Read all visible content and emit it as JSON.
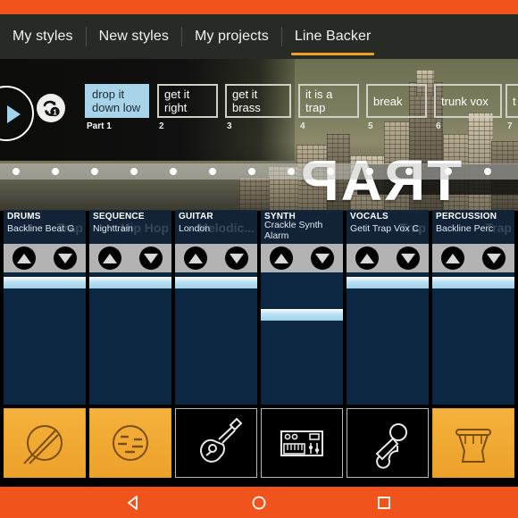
{
  "app": {
    "accent_orange": "#f0531c",
    "tab_underline": "#f0a122",
    "selected_part_blue": "#a8d4ea",
    "track_header_blue": "#132b3c",
    "fader_blue": "#9cd2ec",
    "instrument_active_orange": "#f0a72a"
  },
  "tabs": [
    {
      "label": "My styles",
      "active": false
    },
    {
      "label": "New styles",
      "active": false
    },
    {
      "label": "My projects",
      "active": false
    },
    {
      "label": "Line Backer",
      "active": true
    }
  ],
  "transport": {
    "play_icon": "play-icon",
    "loop_icon": "loop-once-icon",
    "loop_label": "1"
  },
  "background_art": {
    "word": "TRAP"
  },
  "parts": [
    {
      "name": "drop it down low",
      "number": "Part 1",
      "selected": true
    },
    {
      "name": "get it right",
      "number": "2",
      "selected": false
    },
    {
      "name": "get it brass",
      "number": "3",
      "selected": false
    },
    {
      "name": "it is a trap",
      "number": "4",
      "selected": false
    },
    {
      "name": "break",
      "number": "5",
      "selected": false
    },
    {
      "name": "trunk vox",
      "number": "6",
      "selected": false
    },
    {
      "name": "t",
      "number": "7",
      "selected": false
    }
  ],
  "scrollbar": {
    "dot_count": 13
  },
  "tracks": [
    {
      "name": "DRUMS",
      "preset": "Backline Beat G",
      "preset2": "",
      "watermark": "Trap",
      "fader_pct": 96,
      "instrument_icon": "drum-pad-icon",
      "instrument_on": true
    },
    {
      "name": "SEQUENCE",
      "preset": "Nighttrain",
      "preset2": "",
      "watermark": "Hip Hop",
      "fader_pct": 96,
      "instrument_icon": "sequencer-icon",
      "instrument_on": true
    },
    {
      "name": "GUITAR",
      "preset": "London",
      "preset2": "",
      "watermark": "Melodic...",
      "fader_pct": 96,
      "instrument_icon": "guitar-icon",
      "instrument_on": false
    },
    {
      "name": "SYNTH",
      "preset": "Crackle Synth",
      "preset2": "Alarm",
      "watermark": "",
      "fader_pct": 70,
      "instrument_icon": "keyboard-icon",
      "instrument_on": false
    },
    {
      "name": "VOCALS",
      "preset": "Getit Trap Vox C",
      "preset2": "",
      "watermark": "Trap",
      "fader_pct": 96,
      "instrument_icon": "microphone-icon",
      "instrument_on": false
    },
    {
      "name": "PERCUSSION",
      "preset": "Backline Perc",
      "preset2": "",
      "watermark": "Trap",
      "fader_pct": 96,
      "instrument_icon": "djembe-icon",
      "instrument_on": true
    }
  ],
  "track_controls": {
    "up_label": "up-arrow-icon",
    "down_label": "down-arrow-icon"
  },
  "navbar": {
    "back": "back-triangle-icon",
    "home": "home-circle-icon",
    "recents": "recents-square-icon"
  }
}
